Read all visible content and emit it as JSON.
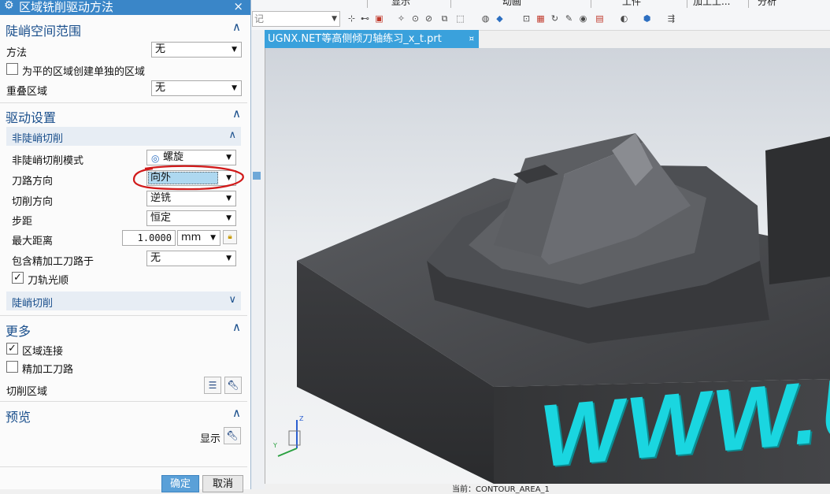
{
  "toolbar": {
    "menu": [
      "显示",
      "动画",
      "工件",
      "加工工...",
      "分析"
    ],
    "filter_placeholder": "记"
  },
  "viewport": {
    "tab_label": "UGNX.NET等高侧倾刀轴练习_x_t.prt",
    "tab_close": "¤",
    "watermark": "WWW.U",
    "axis_z": "Z",
    "axis_y": "Y",
    "status": "当前：CONTOUR_AREA_1"
  },
  "dialog": {
    "title": "区域铣削驱动方法",
    "close": "×",
    "steep_space": {
      "title": "陡峭空间范围",
      "method_label": "方法",
      "method_value": "无",
      "separate_label": "为平的区域创建单独的区域",
      "separate_checked": false,
      "overlap_label": "重叠区域",
      "overlap_value": "无"
    },
    "drive_settings": {
      "title": "驱动设置",
      "non_steep": {
        "title": "非陡峭切削",
        "mode_label": "非陡峭切削模式",
        "mode_value": "螺旋",
        "direction_label": "刀路方向",
        "direction_value": "向外",
        "cut_dir_label": "切削方向",
        "cut_dir_value": "逆铣",
        "stepover_label": "步距",
        "stepover_value": "恒定",
        "max_dist_label": "最大距离",
        "max_dist_value": "1.0000",
        "max_dist_unit": "mm",
        "finish_label": "包含精加工刀路于",
        "finish_value": "无",
        "smooth_label": "刀轨光顺",
        "smooth_checked": true
      },
      "steep": {
        "title": "陡峭切削"
      }
    },
    "more": {
      "title": "更多",
      "region_connect_label": "区域连接",
      "region_connect_checked": true,
      "finish_path_label": "精加工刀路",
      "finish_path_checked": false,
      "cut_region_label": "切削区域"
    },
    "preview": {
      "title": "预览",
      "display_label": "显示"
    },
    "ok_label": "确定",
    "cancel_label": "取消"
  },
  "colors": {
    "title_bar": "#3a86c8",
    "group_title": "#1a4f8c",
    "highlight_field": "#aed8f0",
    "annotation": "#d11a1a",
    "watermark": "#1ad6e0",
    "viewport_tab": "#3aa1dc",
    "ok_button": "#5aa0d8"
  }
}
